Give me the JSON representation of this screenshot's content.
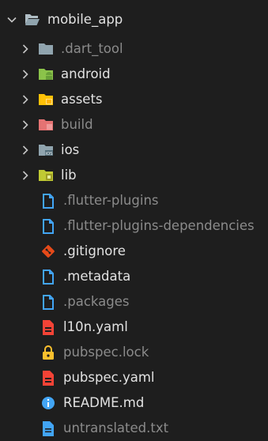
{
  "explorer": {
    "root": {
      "label": "mobile_app",
      "expanded": true
    },
    "folders": [
      {
        "label": ".dart_tool",
        "icon": "folder-dart-tool-icon",
        "dimmed": true
      },
      {
        "label": "android",
        "icon": "folder-android-icon",
        "dimmed": false
      },
      {
        "label": "assets",
        "icon": "folder-assets-icon",
        "dimmed": false
      },
      {
        "label": "build",
        "icon": "folder-build-icon",
        "dimmed": true
      },
      {
        "label": "ios",
        "icon": "folder-ios-icon",
        "dimmed": false
      },
      {
        "label": "lib",
        "icon": "folder-lib-icon",
        "dimmed": false
      }
    ],
    "files": [
      {
        "label": ".flutter-plugins",
        "icon": "file-icon",
        "dimmed": true
      },
      {
        "label": ".flutter-plugins-dependencies",
        "icon": "file-icon",
        "dimmed": true
      },
      {
        "label": ".gitignore",
        "icon": "git-icon",
        "dimmed": false
      },
      {
        "label": ".metadata",
        "icon": "file-icon",
        "dimmed": false
      },
      {
        "label": ".packages",
        "icon": "file-icon",
        "dimmed": true
      },
      {
        "label": "l10n.yaml",
        "icon": "yaml-icon",
        "dimmed": false
      },
      {
        "label": "pubspec.lock",
        "icon": "lock-icon",
        "dimmed": true
      },
      {
        "label": "pubspec.yaml",
        "icon": "yaml-icon",
        "dimmed": false
      },
      {
        "label": "README.md",
        "icon": "info-icon",
        "dimmed": false
      },
      {
        "label": "untranslated.txt",
        "icon": "text-file-icon",
        "dimmed": true
      }
    ]
  },
  "colors": {
    "background": "#1e1e1e",
    "text": "#e2e2e2",
    "text_dimmed": "#8b8b8b",
    "chevron": "#c5c5c5",
    "folder_plain": "#90a4ae",
    "folder_android": "#8bc34a",
    "folder_assets": "#ffc107",
    "folder_build": "#e57373",
    "folder_ios": "#90a4ae",
    "folder_lib": "#c0ca33",
    "file_blue": "#42a5f5",
    "git": "#e64a19",
    "yaml": "#f44336",
    "lock": "#fbc02d",
    "info": "#42a5f5"
  }
}
